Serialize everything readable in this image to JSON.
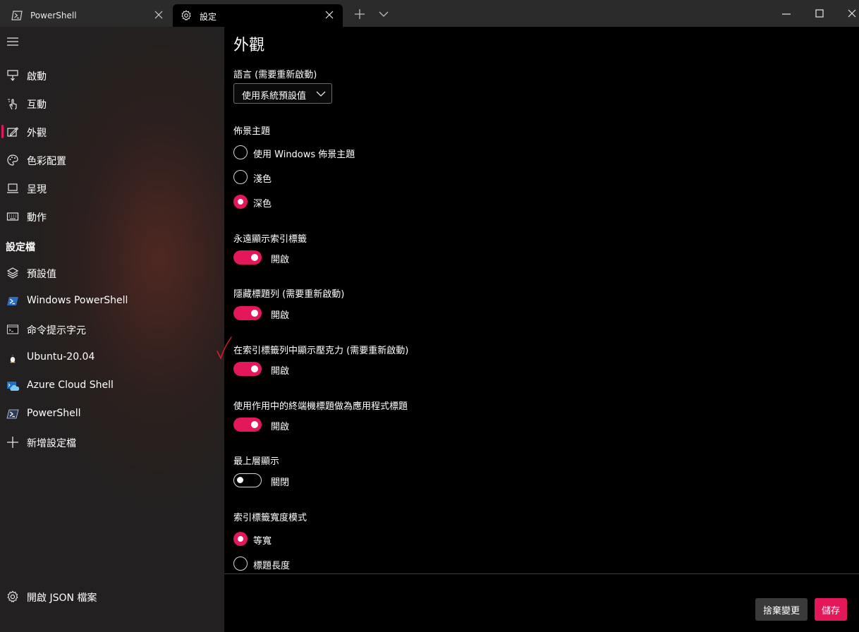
{
  "tabs": [
    {
      "label": "PowerShell",
      "icon": "powershell-icon",
      "active": false
    },
    {
      "label": "設定",
      "icon": "gear-icon",
      "active": true
    }
  ],
  "sidebar": {
    "items": [
      {
        "label": "啟動",
        "icon": "startup-icon"
      },
      {
        "label": "互動",
        "icon": "interaction-icon"
      },
      {
        "label": "外觀",
        "icon": "appearance-icon",
        "selected": true
      },
      {
        "label": "色彩配置",
        "icon": "palette-icon"
      },
      {
        "label": "呈現",
        "icon": "rendering-icon"
      },
      {
        "label": "動作",
        "icon": "keyboard-icon"
      }
    ],
    "profiles_header": "設定檔",
    "profiles": [
      {
        "label": "預設值",
        "icon": "layers-icon"
      },
      {
        "label": "Windows PowerShell",
        "icon": "powershell-icon"
      },
      {
        "label": "命令提示字元",
        "icon": "cmd-icon"
      },
      {
        "label": "Ubuntu-20.04",
        "icon": "linux-icon"
      },
      {
        "label": "Azure Cloud Shell",
        "icon": "azure-icon"
      },
      {
        "label": "PowerShell",
        "icon": "powershell-icon"
      },
      {
        "label": "新增設定檔",
        "icon": "plus-icon"
      }
    ],
    "open_json": "開啟 JSON 檔案"
  },
  "main": {
    "title": "外觀",
    "language": {
      "label": "語言 (需要重新啟動)",
      "value": "使用系統預設值"
    },
    "theme": {
      "label": "佈景主題",
      "options": [
        "使用 Windows 佈景主題",
        "淺色",
        "深色"
      ],
      "selected": "深色"
    },
    "always_show_tabs": {
      "label": "永遠顯示索引標籤",
      "state": "開啟",
      "on": true
    },
    "hide_title_bar": {
      "label": "隱藏標題列 (需要重新啟動)",
      "state": "開啟",
      "on": true
    },
    "acrylic_tab_row": {
      "label": "在索引標籤列中顯示壓克力 (需要重新啟動)",
      "state": "開啟",
      "on": true
    },
    "use_active_terminal_title": {
      "label": "使用作用中的終端機標題做為應用程式標題",
      "state": "開啟",
      "on": true
    },
    "always_on_top": {
      "label": "最上層顯示",
      "state": "關閉",
      "on": false
    },
    "tab_width_mode": {
      "label": "索引標籤寬度模式",
      "options": [
        "等寬",
        "標題長度"
      ],
      "selected": "等寬"
    }
  },
  "footer": {
    "discard": "捨棄變更",
    "save": "儲存"
  },
  "colors": {
    "accent": "#e3175a",
    "annotation": "#d81b2a"
  }
}
